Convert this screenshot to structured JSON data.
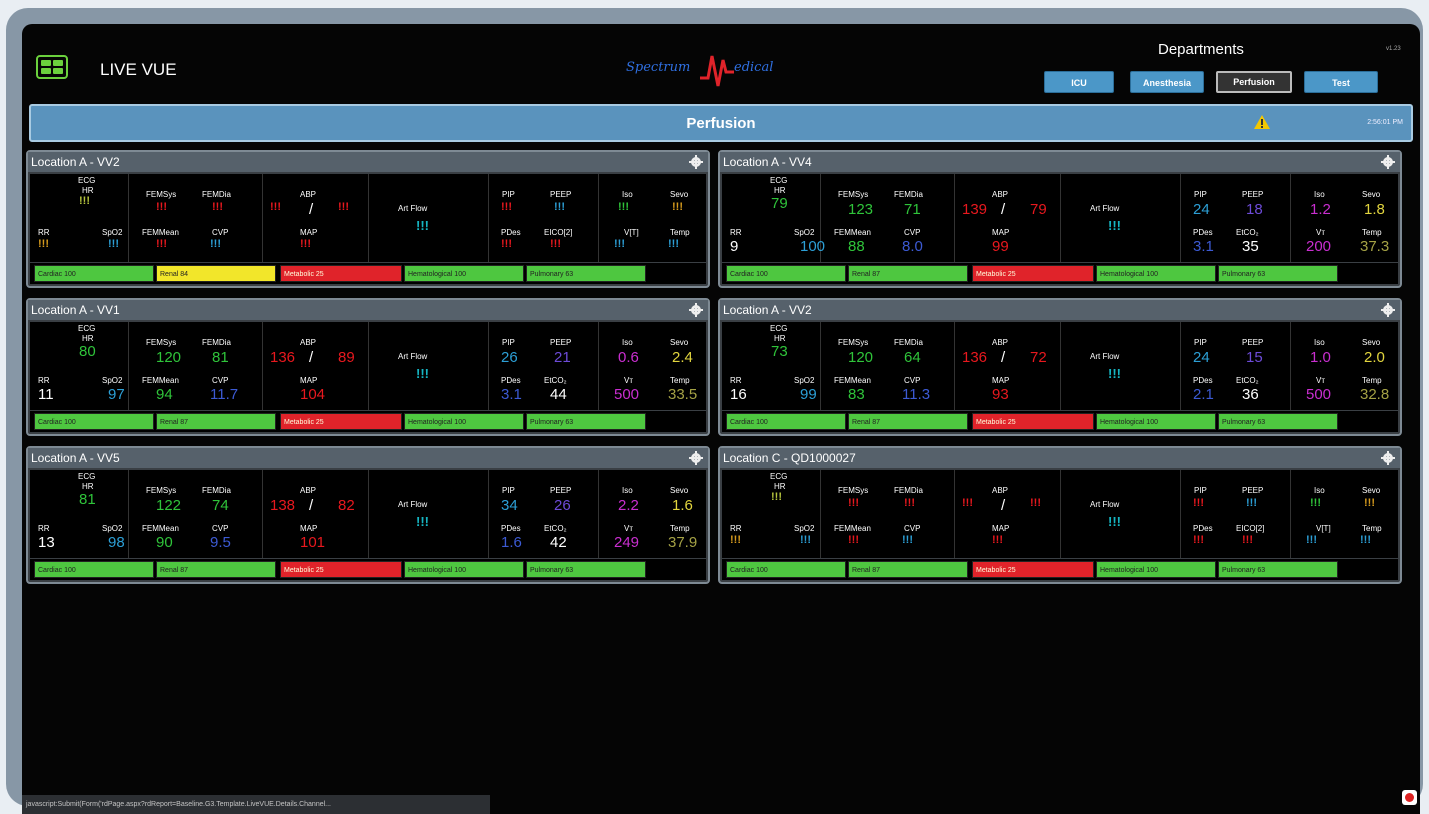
{
  "header": {
    "app_title": "LIVE VUE",
    "logo_left": "Spectrum",
    "logo_right": "edical",
    "departments_title": "Departments",
    "version": "v1.23",
    "departments": [
      {
        "label": "ICU",
        "active": false
      },
      {
        "label": "Anesthesia",
        "active": false
      },
      {
        "label": "Perfusion",
        "active": true
      },
      {
        "label": "Test",
        "active": false
      }
    ]
  },
  "banner": {
    "title": "Perfusion",
    "time": "2:56:01 PM"
  },
  "labels": {
    "ecg": "ECG",
    "hr": "HR",
    "rr": "RR",
    "spo2": "SpO2",
    "femsys": "FEMSys",
    "femdia": "FEMDia",
    "femmean": "FEMMean",
    "cvp": "CVP",
    "abp": "ABP",
    "slash": "/",
    "map": "MAP",
    "artflow": "Art Flow",
    "pip": "PIP",
    "peep": "PEEP",
    "pdes": "PDes",
    "iso": "Iso",
    "sevo": "Sevo",
    "temp": "Temp"
  },
  "panels": [
    {
      "title": "Location A - VV2",
      "labels_alt": {
        "eico": "EICO[2]",
        "vt": "V[T]"
      },
      "values": {
        "hr": "!!!",
        "rr": "!!!",
        "spo2": "!!!",
        "femsys": "!!!",
        "femdia": "!!!",
        "femmean": "!!!",
        "cvp": "!!!",
        "abp_sys": "!!!",
        "abp_dia": "!!!",
        "map": "!!!",
        "artflow": "!!!",
        "pip": "!!!",
        "peep": "!!!",
        "pdes": "!!!",
        "eico": "!!!",
        "iso": "!!!",
        "sevo": "!!!",
        "vt": "!!!",
        "temp": "!!!"
      },
      "scores": [
        {
          "label": "Cardiac",
          "value": "100",
          "color": "green"
        },
        {
          "label": "Renal",
          "value": "84",
          "color": "yellow"
        },
        {
          "label": "Metabolic",
          "value": "25",
          "color": "red"
        },
        {
          "label": "Hematological",
          "value": "100",
          "color": "green"
        },
        {
          "label": "Pulmonary",
          "value": "63",
          "color": "green"
        }
      ]
    },
    {
      "title": "Location A - VV4",
      "labels_alt": {
        "eico": "EtCO₂",
        "vt": "Vт"
      },
      "values": {
        "hr": "79",
        "rr": "9",
        "spo2": "100",
        "femsys": "123",
        "femdia": "71",
        "femmean": "88",
        "cvp": "8.0",
        "abp_sys": "139",
        "abp_dia": "79",
        "map": "99",
        "artflow": "!!!",
        "pip": "24",
        "peep": "18",
        "pdes": "3.1",
        "eico": "35",
        "iso": "1.2",
        "sevo": "1.8",
        "vt": "200",
        "temp": "37.3"
      },
      "scores": [
        {
          "label": "Cardiac",
          "value": "100",
          "color": "green"
        },
        {
          "label": "Renal",
          "value": "87",
          "color": "green"
        },
        {
          "label": "Metabolic",
          "value": "25",
          "color": "red"
        },
        {
          "label": "Hematological",
          "value": "100",
          "color": "green"
        },
        {
          "label": "Pulmonary",
          "value": "63",
          "color": "green"
        }
      ]
    },
    {
      "title": "Location A - VV1",
      "labels_alt": {
        "eico": "EtCO₂",
        "vt": "Vт"
      },
      "values": {
        "hr": "80",
        "rr": "11",
        "spo2": "97",
        "femsys": "120",
        "femdia": "81",
        "femmean": "94",
        "cvp": "11.7",
        "abp_sys": "136",
        "abp_dia": "89",
        "map": "104",
        "artflow": "!!!",
        "pip": "26",
        "peep": "21",
        "pdes": "3.1",
        "eico": "44",
        "iso": "0.6",
        "sevo": "2.4",
        "vt": "500",
        "temp": "33.5"
      },
      "scores": [
        {
          "label": "Cardiac",
          "value": "100",
          "color": "green"
        },
        {
          "label": "Renal",
          "value": "87",
          "color": "green"
        },
        {
          "label": "Metabolic",
          "value": "25",
          "color": "red"
        },
        {
          "label": "Hematological",
          "value": "100",
          "color": "green"
        },
        {
          "label": "Pulmonary",
          "value": "63",
          "color": "green"
        }
      ]
    },
    {
      "title": "Location A - VV2",
      "labels_alt": {
        "eico": "EtCO₂",
        "vt": "Vт"
      },
      "values": {
        "hr": "73",
        "rr": "16",
        "spo2": "99",
        "femsys": "120",
        "femdia": "64",
        "femmean": "83",
        "cvp": "11.3",
        "abp_sys": "136",
        "abp_dia": "72",
        "map": "93",
        "artflow": "!!!",
        "pip": "24",
        "peep": "15",
        "pdes": "2.1",
        "eico": "36",
        "iso": "1.0",
        "sevo": "2.0",
        "vt": "500",
        "temp": "32.8"
      },
      "scores": [
        {
          "label": "Cardiac",
          "value": "100",
          "color": "green"
        },
        {
          "label": "Renal",
          "value": "87",
          "color": "green"
        },
        {
          "label": "Metabolic",
          "value": "25",
          "color": "red"
        },
        {
          "label": "Hematological",
          "value": "100",
          "color": "green"
        },
        {
          "label": "Pulmonary",
          "value": "63",
          "color": "green"
        }
      ]
    },
    {
      "title": "Location A - VV5",
      "labels_alt": {
        "eico": "EtCO₂",
        "vt": "Vт"
      },
      "values": {
        "hr": "81",
        "rr": "13",
        "spo2": "98",
        "femsys": "122",
        "femdia": "74",
        "femmean": "90",
        "cvp": "9.5",
        "abp_sys": "138",
        "abp_dia": "82",
        "map": "101",
        "artflow": "!!!",
        "pip": "34",
        "peep": "26",
        "pdes": "1.6",
        "eico": "42",
        "iso": "2.2",
        "sevo": "1.6",
        "vt": "249",
        "temp": "37.9"
      },
      "scores": [
        {
          "label": "Cardiac",
          "value": "100",
          "color": "green"
        },
        {
          "label": "Renal",
          "value": "87",
          "color": "green"
        },
        {
          "label": "Metabolic",
          "value": "25",
          "color": "red"
        },
        {
          "label": "Hematological",
          "value": "100",
          "color": "green"
        },
        {
          "label": "Pulmonary",
          "value": "63",
          "color": "green"
        }
      ]
    },
    {
      "title": "Location C - QD1000027",
      "labels_alt": {
        "eico": "EICO[2]",
        "vt": "V[T]"
      },
      "values": {
        "hr": "!!!",
        "rr": "!!!",
        "spo2": "!!!",
        "femsys": "!!!",
        "femdia": "!!!",
        "femmean": "!!!",
        "cvp": "!!!",
        "abp_sys": "!!!",
        "abp_dia": "!!!",
        "map": "!!!",
        "artflow": "!!!",
        "pip": "!!!",
        "peep": "!!!",
        "pdes": "!!!",
        "eico": "!!!",
        "iso": "!!!",
        "sevo": "!!!",
        "vt": "!!!",
        "temp": "!!!"
      },
      "scores": [
        {
          "label": "Cardiac",
          "value": "100",
          "color": "green"
        },
        {
          "label": "Renal",
          "value": "87",
          "color": "green"
        },
        {
          "label": "Metabolic",
          "value": "25",
          "color": "red"
        },
        {
          "label": "Hematological",
          "value": "100",
          "color": "green"
        },
        {
          "label": "Pulmonary",
          "value": "63",
          "color": "green"
        }
      ]
    }
  ],
  "status_bar": {
    "url": "javascript:Submit(Form('rdPage.aspx?rdReport=Baseline.G3.Template.LiveVUE.Details.Channel..."
  },
  "colors": {
    "banner": "#5a93bd",
    "button_inactive": "#4b97c8",
    "ok": "#4ec740",
    "warn": "#f2e62a",
    "alarm": "#e0232a"
  }
}
